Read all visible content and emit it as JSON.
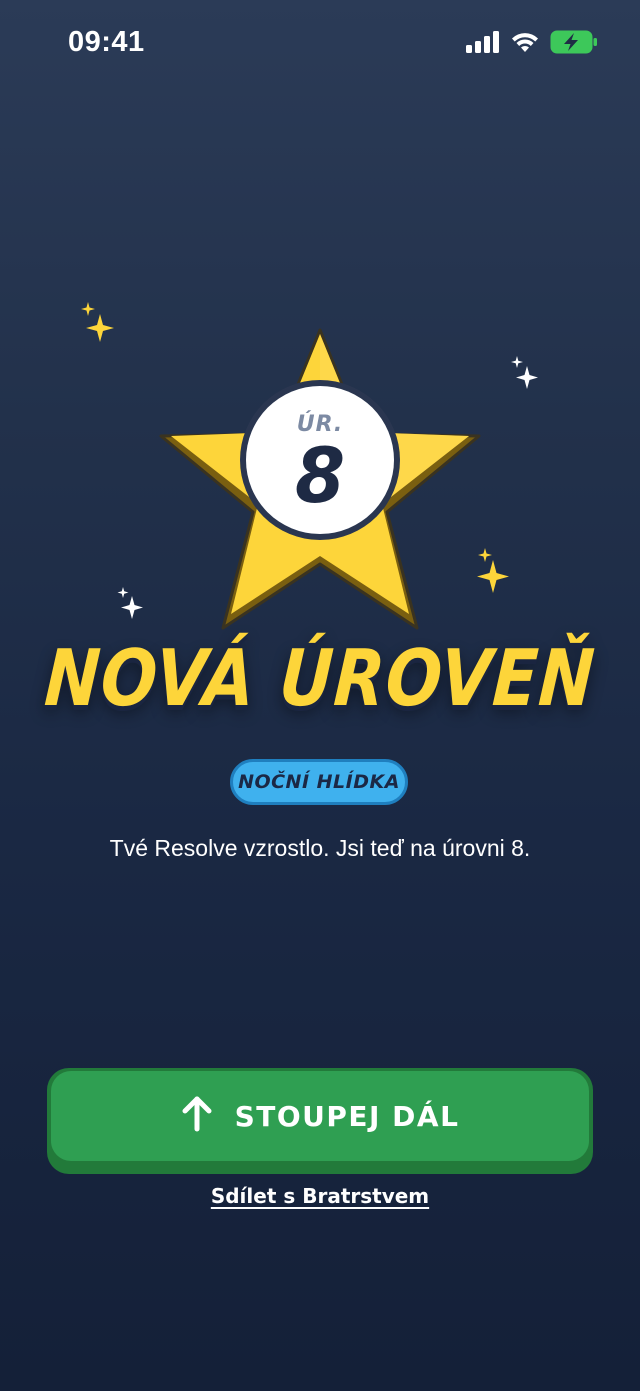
{
  "status_bar": {
    "time": "09:41",
    "icons": [
      "signal-icon",
      "wifi-icon",
      "battery-charging-icon"
    ]
  },
  "level_badge": {
    "prefix": "ÚR.",
    "level": "8"
  },
  "title": "NOVÁ ÚROVEŇ",
  "rank_badge": "NOČNÍ HLÍDKA",
  "message": "Tvé Resolve vzrostlo. Jsi teď na úrovni 8.",
  "primary_button": {
    "label": "STOUPEJ DÁL",
    "icon": "arrow-up-icon"
  },
  "share_link": "Sdílet s Bratrstvem",
  "colors": {
    "star": "#fdd53a",
    "star_shadow": "#8a6d12",
    "accent_blue": "#3fb1ee",
    "button_green": "#2f9f52",
    "background_top": "#2b3b57",
    "background_bottom": "#142038"
  }
}
